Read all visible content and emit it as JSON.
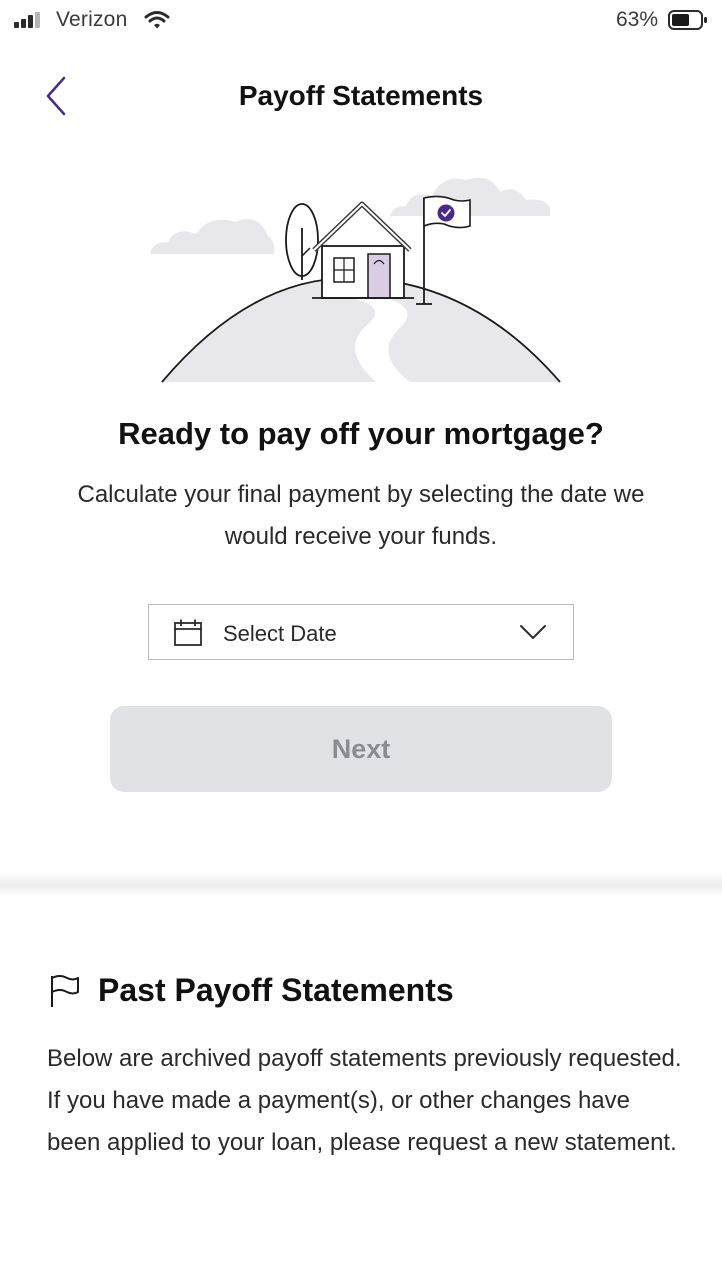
{
  "status_bar": {
    "carrier": "Verizon",
    "battery_percent": "63%",
    "battery_level": 0.63,
    "signal_icon": "signal-bars-icon",
    "wifi_icon": "wifi-icon",
    "battery_icon": "battery-icon"
  },
  "header": {
    "title": "Payoff Statements",
    "back_icon": "chevron-left-icon"
  },
  "hero": {
    "illustration": "house-on-hill-illustration",
    "flag_icon": "check-flag-icon"
  },
  "main": {
    "headline": "Ready to pay off your mortgage?",
    "description": "Calculate your final payment by selecting the date we would receive your funds."
  },
  "date_select": {
    "placeholder": "Select Date",
    "calendar_icon": "calendar-icon",
    "chevron_icon": "chevron-down-icon"
  },
  "next_button": {
    "label": "Next",
    "disabled": true
  },
  "past": {
    "title": "Past Payoff Statements",
    "flag_icon": "flag-icon",
    "description": "Below are archived payoff statements previously requested. If you have made a payment(s), or other changes have been applied to your loan, please request a new statement."
  },
  "colors": {
    "accent": "#4b2a86",
    "button_bg": "#e1e2e6",
    "button_text": "#8b8c91",
    "hill": "#e7e7ec",
    "door": "#d9cde6"
  }
}
